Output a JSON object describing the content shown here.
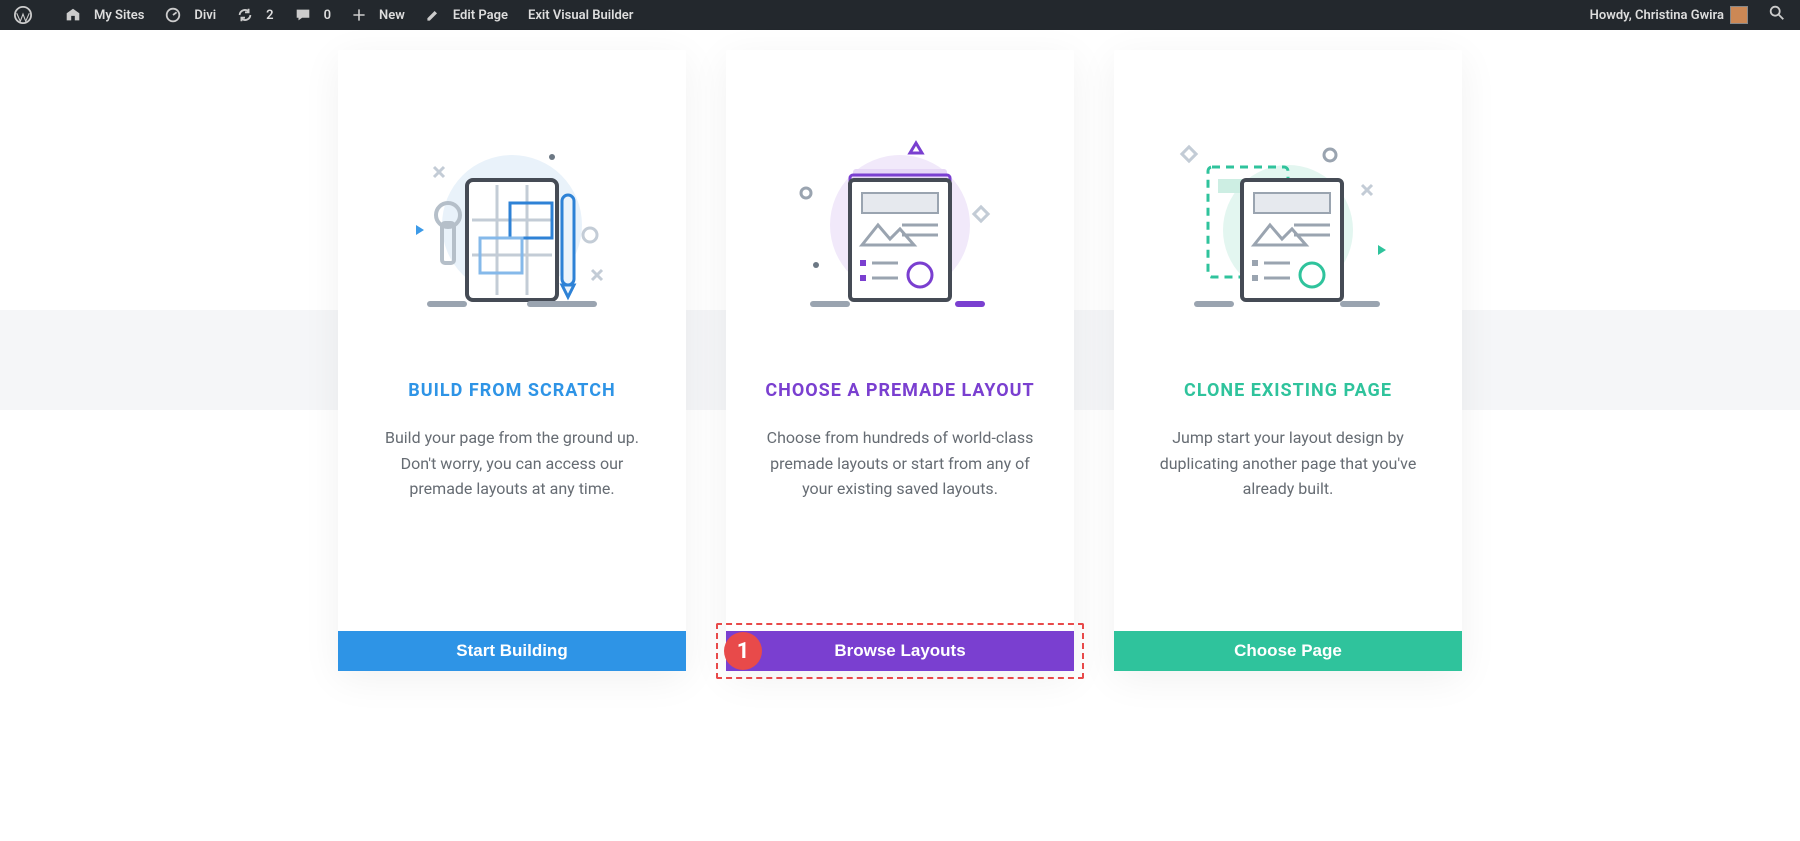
{
  "admin_bar": {
    "my_sites": "My Sites",
    "site_name": "Divi",
    "updates": "2",
    "comments": "0",
    "new": "New",
    "edit_page": "Edit Page",
    "exit_vb": "Exit Visual Builder",
    "howdy": "Howdy, Christina Gwira"
  },
  "cards": [
    {
      "title": "BUILD FROM SCRATCH",
      "desc": "Build your page from the ground up. Don't worry, you can access our premade layouts at any time.",
      "cta": "Start Building"
    },
    {
      "title": "CHOOSE A PREMADE LAYOUT",
      "desc": "Choose from hundreds of world-class premade layouts or start from any of your existing saved layouts.",
      "cta": "Browse Layouts"
    },
    {
      "title": "CLONE EXISTING PAGE",
      "desc": "Jump start your layout design by duplicating another page that you've already built.",
      "cta": "Choose Page"
    }
  ],
  "annotation": {
    "number": "1"
  }
}
